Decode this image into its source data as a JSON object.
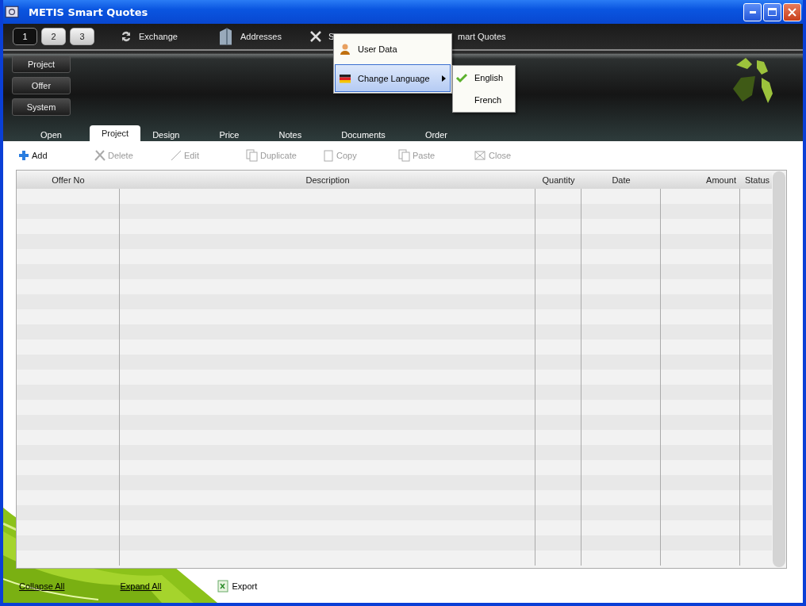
{
  "window": {
    "title": "METIS Smart Quotes"
  },
  "pages": [
    {
      "label": "1",
      "selected": true
    },
    {
      "label": "2",
      "selected": false
    },
    {
      "label": "3",
      "selected": false
    }
  ],
  "top_menu": [
    {
      "label": "Exchange",
      "kind": "exchange"
    },
    {
      "label": "Addresses",
      "kind": "addresses"
    },
    {
      "label": "S",
      "kind": "tools"
    },
    {
      "label": "mart Quotes",
      "kind": "none"
    }
  ],
  "side_buttons": [
    "Project",
    "Offer",
    "System"
  ],
  "tabs": [
    {
      "label": "Open",
      "selected": false
    },
    {
      "label": "Project",
      "selected": true
    },
    {
      "label": "Design",
      "selected": false
    },
    {
      "label": "Price",
      "selected": false
    },
    {
      "label": "Notes",
      "selected": false
    },
    {
      "label": "Documents",
      "selected": false
    },
    {
      "label": "Order",
      "selected": false
    }
  ],
  "toolbar": [
    {
      "label": "Add",
      "kind": "add",
      "disabled": false
    },
    {
      "label": "Delete",
      "kind": "delete",
      "disabled": true
    },
    {
      "label": "Edit",
      "kind": "edit",
      "disabled": true
    },
    {
      "label": "Duplicate",
      "kind": "duplicate",
      "disabled": true
    },
    {
      "label": "Copy",
      "kind": "copy",
      "disabled": true
    },
    {
      "label": "Paste",
      "kind": "paste",
      "disabled": true
    },
    {
      "label": "Close",
      "kind": "close",
      "disabled": true
    }
  ],
  "table": {
    "columns": [
      "Offer No",
      "Description",
      "Quantity",
      "Date",
      "Amount",
      "Status"
    ]
  },
  "footer": {
    "links": [
      "Collapse All",
      "Expand All"
    ],
    "export": "Export"
  },
  "menu": {
    "items": [
      {
        "label": "User Data",
        "kind": "user",
        "selected": false
      },
      {
        "label": "Change Language",
        "kind": "language",
        "selected": true
      }
    ],
    "submenu": [
      {
        "label": "English",
        "checked": true
      },
      {
        "label": "French",
        "checked": false
      }
    ]
  }
}
